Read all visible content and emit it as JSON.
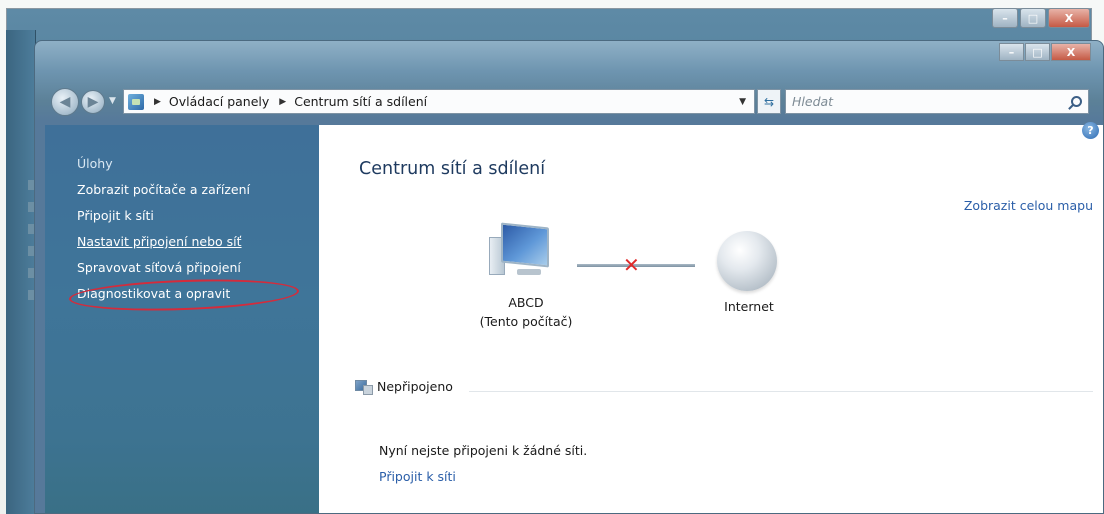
{
  "window": {
    "caption_buttons": [
      "–",
      "□",
      "X"
    ]
  },
  "address_bar": {
    "path": [
      "Ovládací panely",
      "Centrum sítí a sdílení"
    ],
    "search_placeholder": "Hledat"
  },
  "sidebar": {
    "heading": "Úlohy",
    "items": [
      "Zobrazit počítače a zařízení",
      "Připojit k síti",
      "Nastavit připojení nebo síť",
      "Spravovat síťová připojení",
      "Diagnostikovat a opravit"
    ],
    "highlighted_index": 3
  },
  "main": {
    "title": "Centrum sítí a sdílení",
    "map_link": "Zobrazit celou mapu",
    "computer_name": "ABCD",
    "computer_sub": "(Tento počítač)",
    "internet_label": "Internet",
    "status": "Nepřipojeno",
    "message": "Nyní nejste připojeni k žádné síti.",
    "connect_link": "Připojit k síti"
  },
  "colors": {
    "sidebar": "#3f7099",
    "highlight_ellipse": "#d52b3b",
    "link": "#2a5ea8",
    "disconnect_x": "#e02a2a"
  }
}
